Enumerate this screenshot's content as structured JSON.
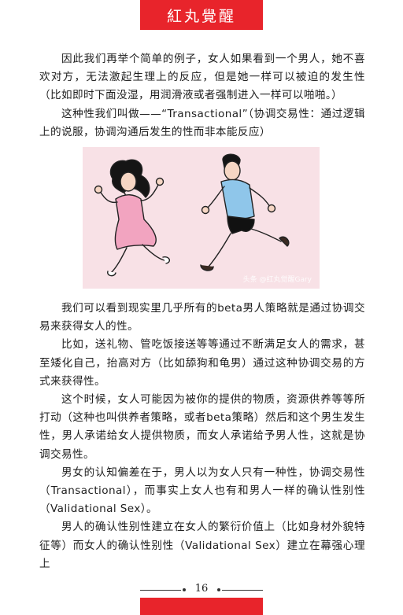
{
  "header": {
    "title": "紅丸覺醒",
    "accent_color": "#e8242b"
  },
  "paragraphs_top": [
    "因此我们再举个简单的例子，女人如果看到一个男人，她不喜欢对方，无法激起生理上的反应，但是她一样可以被迫的发生性（比如即时下面没湿，用润滑液或者强制进入一样可以啪啪。）",
    "这种性我们叫做——“Transactional”（协调交易性：通过逻辑上的说服，协调沟通后发生的性而非本能反应）"
  ],
  "figure": {
    "description_icon": "running-couple-illustration",
    "watermark": "头条 @红丸觉醒Gary"
  },
  "paragraphs_bottom": [
    "我们可以看到现实里几乎所有的beta男人策略就是通过协调交易来获得女人的性。",
    "比如，送礼物、管吃饭接送等等通过不断满足女人的需求，甚至矮化自己，抬高对方（比如舔狗和龟男）通过这种协调交易的方式来获得性。",
    "这个时候，女人可能因为被你的提供的物质，资源供养等等所打动（这种也叫供养者策略，或者beta策略）然后和这个男生发生性，男人承诺给女人提供物质，而女人承诺给予男人性，这就是协调交易性。",
    "男女的认知偏差在于，男人以为女人只有一种性，协调交易性（Transactional），而事实上女人也有和男人一样的确认性别性（Validational Sex）。",
    "男人的确认性别性建立在女人的繁衍价值上（比如身材外貌特征等）而女人的确认性别性（Validational Sex）建立在幕强心理上"
  ],
  "footer": {
    "page_number": "16"
  }
}
